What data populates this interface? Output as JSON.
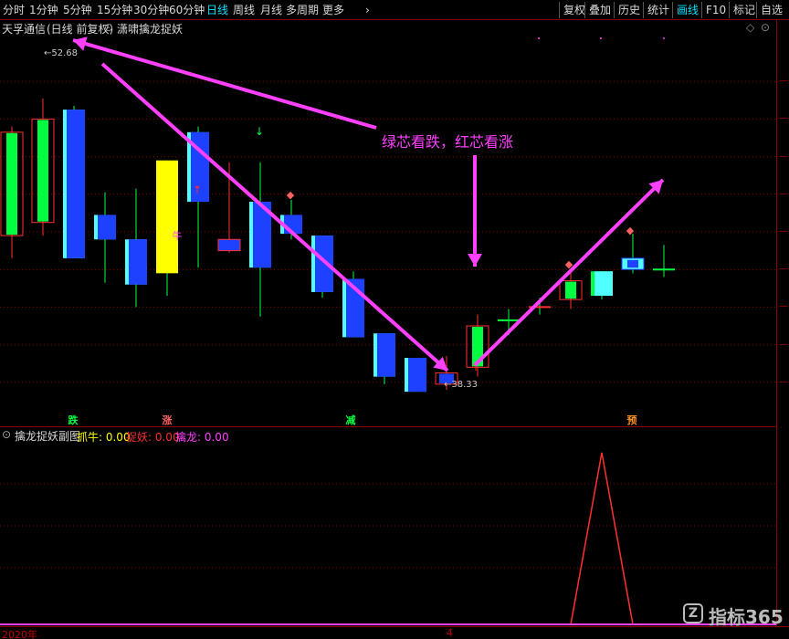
{
  "toolbar": {
    "timeframes": [
      "分时",
      "1分钟",
      "5分钟",
      "15分钟",
      "30分钟",
      "60分钟",
      "日线",
      "周线",
      "月线",
      "多周期",
      "更多"
    ],
    "active_timeframe": "日线",
    "right_buttons": [
      "复权",
      "叠加",
      "历史",
      "统计",
      "画线",
      "F10",
      "标记",
      "自选"
    ],
    "active_right": "画线"
  },
  "title": {
    "stock": "天孚通信",
    "mode": "(日线 前复权)",
    "indicator": "潇啸擒龙捉妖"
  },
  "annotation": {
    "text": "绿芯看跌，红芯看涨",
    "high_label": "52.68",
    "low_label": "38.33"
  },
  "signals": {
    "die": "跌",
    "zhang": "涨",
    "jian": "减",
    "yu": "预",
    "niu": "牛"
  },
  "subchart": {
    "name": "擒龙捉妖副图",
    "items": [
      {
        "label": "抓牛:",
        "value": "0.00",
        "color": "#ffff00"
      },
      {
        "label": "捉妖:",
        "value": "0.00",
        "color": "#ff3030"
      },
      {
        "label": "擒龙:",
        "value": "0.00",
        "color": "#ff40ff"
      }
    ]
  },
  "bottom_axis": {
    "year": "2020年",
    "month": "4"
  },
  "watermark": {
    "logo": "Z",
    "text": "指标365"
  },
  "colors": {
    "up": "#ff3030",
    "down_blue": "#1e40ff",
    "cyan": "#50ffff",
    "green": "#00ff40",
    "yellow": "#ffff00",
    "magenta": "#ff40ff",
    "grid": "#8b0000"
  },
  "chart_data": {
    "type": "candlestick",
    "ylim": [
      36,
      56
    ],
    "candles": [
      {
        "open": 45.8,
        "close": 51.3,
        "high": 51.6,
        "low": 44.6,
        "style": "red-green"
      },
      {
        "open": 46.5,
        "close": 52.0,
        "high": 53.1,
        "low": 45.8,
        "style": "red-green"
      },
      {
        "open": 52.5,
        "close": 44.6,
        "high": 52.7,
        "low": 44.6,
        "style": "blue-cyan"
      },
      {
        "open": 46.9,
        "close": 45.6,
        "high": 48.1,
        "low": 43.3,
        "style": "blue-cyan"
      },
      {
        "open": 45.6,
        "close": 43.2,
        "high": 48.3,
        "low": 42.0,
        "style": "blue-cyan"
      },
      {
        "open": 49.8,
        "close": 43.8,
        "high": 49.8,
        "low": 42.6,
        "style": "yellow"
      },
      {
        "open": 51.3,
        "close": 47.6,
        "high": 51.6,
        "low": 44.1,
        "style": "blue-cyan"
      },
      {
        "open": 45.6,
        "close": 45.0,
        "high": 49.7,
        "low": 44.9,
        "style": "red-outline"
      },
      {
        "open": 47.6,
        "close": 44.1,
        "high": 49.7,
        "low": 41.5,
        "style": "blue-cyan"
      },
      {
        "open": 46.9,
        "close": 45.9,
        "high": 47.7,
        "low": 45.6,
        "style": "blue-cyan"
      },
      {
        "open": 45.8,
        "close": 42.8,
        "high": 45.8,
        "low": 42.5,
        "style": "blue-cyan"
      },
      {
        "open": 43.5,
        "close": 40.4,
        "high": 43.9,
        "low": 40.4,
        "style": "blue-cyan"
      },
      {
        "open": 40.6,
        "close": 38.3,
        "high": 40.6,
        "low": 37.9,
        "style": "blue-cyan"
      },
      {
        "open": 39.3,
        "close": 37.5,
        "high": 39.3,
        "low": 37.5,
        "style": "blue-cyan"
      },
      {
        "open": 38.5,
        "close": 37.9,
        "high": 39.4,
        "low": 37.6,
        "style": "red-outline-blue"
      },
      {
        "open": 38.8,
        "close": 41.0,
        "high": 41.6,
        "low": 38.3,
        "style": "red-green"
      },
      {
        "open": 41.2,
        "close": 41.3,
        "high": 41.9,
        "low": 40.5,
        "style": "doji-green"
      },
      {
        "open": 41.9,
        "close": 42.0,
        "high": 42.5,
        "low": 41.6,
        "style": "doji-red"
      },
      {
        "open": 42.4,
        "close": 43.4,
        "high": 43.9,
        "low": 41.9,
        "style": "red-green"
      },
      {
        "open": 42.6,
        "close": 43.9,
        "high": 43.9,
        "low": 42.4,
        "style": "green-cyan"
      },
      {
        "open": 44.0,
        "close": 44.6,
        "high": 45.9,
        "low": 43.8,
        "style": "cyan-outline"
      },
      {
        "open": 44.1,
        "close": 44.0,
        "high": 45.3,
        "low": 43.6,
        "style": "doji-green"
      }
    ],
    "subchart_series": {
      "name": "捉妖",
      "values": [
        0,
        0,
        0,
        0,
        0,
        0,
        0,
        0,
        0,
        0,
        0,
        0,
        0,
        0,
        0,
        0,
        0,
        0,
        0,
        0.95,
        0,
        0
      ]
    }
  }
}
